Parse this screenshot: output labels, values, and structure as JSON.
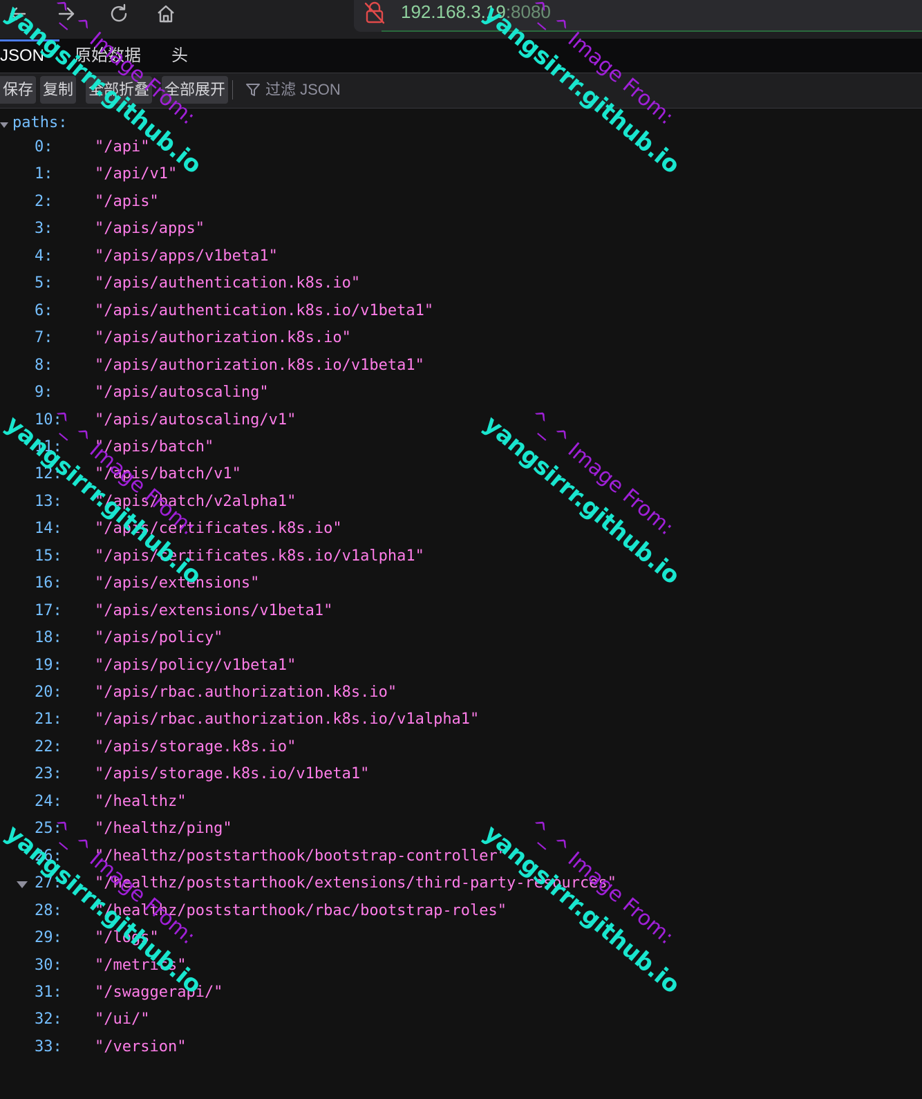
{
  "browser": {
    "url_host": "192.168.3.19",
    "url_port": ":8080"
  },
  "tabs": {
    "json": "JSON",
    "raw": "原始数据",
    "headers": "头"
  },
  "toolbar": {
    "save": "保存",
    "copy": "复制",
    "collapse_all": "全部折叠",
    "expand_all": "全部展开",
    "filter_placeholder": "过滤 JSON"
  },
  "tree": {
    "root_key": "paths:",
    "items": [
      {
        "key": "0:",
        "value": "\"/api\""
      },
      {
        "key": "1:",
        "value": "\"/api/v1\""
      },
      {
        "key": "2:",
        "value": "\"/apis\""
      },
      {
        "key": "3:",
        "value": "\"/apis/apps\""
      },
      {
        "key": "4:",
        "value": "\"/apis/apps/v1beta1\""
      },
      {
        "key": "5:",
        "value": "\"/apis/authentication.k8s.io\""
      },
      {
        "key": "6:",
        "value": "\"/apis/authentication.k8s.io/v1beta1\""
      },
      {
        "key": "7:",
        "value": "\"/apis/authorization.k8s.io\""
      },
      {
        "key": "8:",
        "value": "\"/apis/authorization.k8s.io/v1beta1\""
      },
      {
        "key": "9:",
        "value": "\"/apis/autoscaling\""
      },
      {
        "key": "10:",
        "value": "\"/apis/autoscaling/v1\""
      },
      {
        "key": "11:",
        "value": "\"/apis/batch\""
      },
      {
        "key": "12:",
        "value": "\"/apis/batch/v1\""
      },
      {
        "key": "13:",
        "value": "\"/apis/batch/v2alpha1\""
      },
      {
        "key": "14:",
        "value": "\"/apis/certificates.k8s.io\""
      },
      {
        "key": "15:",
        "value": "\"/apis/certificates.k8s.io/v1alpha1\""
      },
      {
        "key": "16:",
        "value": "\"/apis/extensions\""
      },
      {
        "key": "17:",
        "value": "\"/apis/extensions/v1beta1\""
      },
      {
        "key": "18:",
        "value": "\"/apis/policy\""
      },
      {
        "key": "19:",
        "value": "\"/apis/policy/v1beta1\""
      },
      {
        "key": "20:",
        "value": "\"/apis/rbac.authorization.k8s.io\""
      },
      {
        "key": "21:",
        "value": "\"/apis/rbac.authorization.k8s.io/v1alpha1\""
      },
      {
        "key": "22:",
        "value": "\"/apis/storage.k8s.io\""
      },
      {
        "key": "23:",
        "value": "\"/apis/storage.k8s.io/v1beta1\""
      },
      {
        "key": "24:",
        "value": "\"/healthz\""
      },
      {
        "key": "25:",
        "value": "\"/healthz/ping\""
      },
      {
        "key": "26:",
        "value": "\"/healthz/poststarthook/bootstrap-controller\""
      },
      {
        "key": "27:",
        "value": "\"/healthz/poststarthook/extensions/third-party-resources\""
      },
      {
        "key": "28:",
        "value": "\"/healthz/poststarthook/rbac/bootstrap-roles\""
      },
      {
        "key": "29:",
        "value": "\"/logs\""
      },
      {
        "key": "30:",
        "value": "\"/metrics\""
      },
      {
        "key": "31:",
        "value": "\"/swaggerapi/\""
      },
      {
        "key": "32:",
        "value": "\"/ui/\""
      },
      {
        "key": "33:",
        "value": "\"/version\""
      }
    ]
  },
  "watermark": {
    "line_a": "^_^ Image From:",
    "line_b": "yangsirrr.github.io"
  }
}
